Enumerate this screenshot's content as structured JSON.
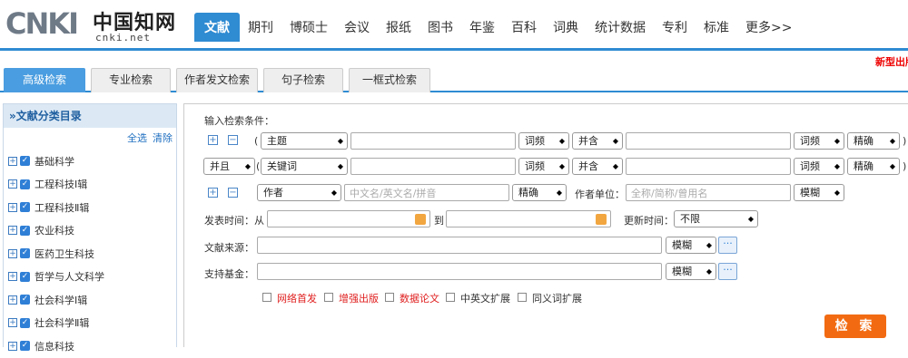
{
  "logo": {
    "brand": "CNKI",
    "chinese": "中国知网",
    "url": "cnki.net"
  },
  "nav": [
    "文献",
    "期刊",
    "博硕士",
    "会议",
    "报纸",
    "图书",
    "年鉴",
    "百科",
    "词典",
    "统计数据",
    "专利",
    "标准",
    "更多>>"
  ],
  "promo": "新型出版",
  "tabs": [
    "高级检索",
    "专业检索",
    "作者发文检索",
    "句子检索",
    "一框式检索"
  ],
  "sidebar": {
    "title": "»文献分类目录",
    "select_all": "全选",
    "clear": "清除",
    "items": [
      "基础科学",
      "工程科技Ⅰ辑",
      "工程科技Ⅱ辑",
      "农业科技",
      "医药卫生科技",
      "哲学与人文科学",
      "社会科学Ⅰ辑",
      "社会科学Ⅱ辑",
      "信息科技"
    ]
  },
  "form": {
    "title": "输入检索条件：",
    "row1": {
      "field": "主题",
      "freq1": "词频",
      "logic": "并含",
      "freq2": "词频",
      "match": "精确"
    },
    "row2": {
      "bool": "并且",
      "field": "关键词",
      "freq1": "词频",
      "logic": "并含",
      "freq2": "词频",
      "match": "精确"
    },
    "row3": {
      "field": "作者",
      "placeholder": "中文名/英文名/拼音",
      "match": "精确",
      "unit_label": "作者单位：",
      "unit_placeholder": "全称/简称/曾用名",
      "unit_match": "模糊"
    },
    "date": {
      "label": "发表时间：",
      "from": "从",
      "to": "到",
      "update_label": "更新时间：",
      "update_value": "不限"
    },
    "source": {
      "label": "文献来源：",
      "match": "模糊"
    },
    "fund": {
      "label": "支持基金：",
      "match": "模糊"
    },
    "options": [
      "网络首发",
      "增强出版",
      "数据论文",
      "中英文扩展",
      "同义词扩展"
    ],
    "search": "检 索"
  }
}
